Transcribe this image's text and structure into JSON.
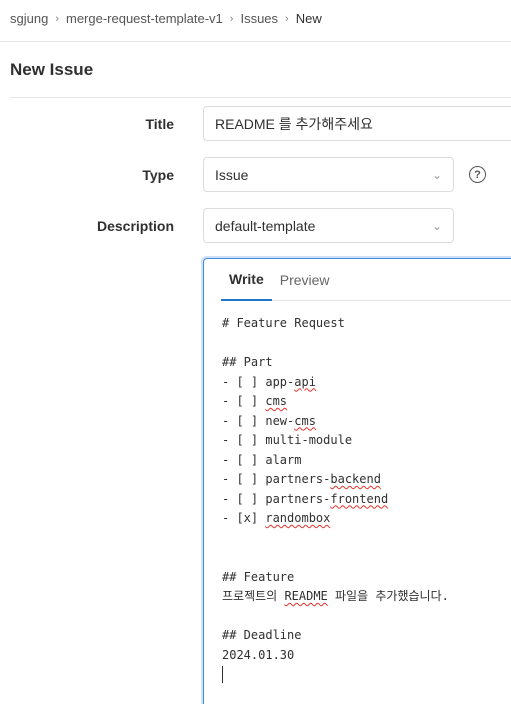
{
  "breadcrumb": {
    "items": [
      "sgjung",
      "merge-request-template-v1",
      "Issues",
      "New"
    ],
    "separator": "›"
  },
  "page": {
    "title": "New Issue"
  },
  "form": {
    "title_label": "Title",
    "title_value": "README 를 추가해주세요",
    "type_label": "Type",
    "type_value": "Issue",
    "help_icon": "?",
    "description_label": "Description",
    "template_value": "default-template"
  },
  "editor": {
    "tabs": [
      {
        "label": "Write",
        "active": true
      },
      {
        "label": "Preview",
        "active": false
      }
    ],
    "lines": [
      "# Feature Request",
      "",
      "## Part",
      "- [ ] app-api",
      "- [ ] cms",
      "- [ ] new-cms",
      "- [ ] multi-module",
      "- [ ] alarm",
      "- [ ] partners-backend",
      "- [ ] partners-frontend",
      "- [x] randombox",
      "",
      "",
      "## Feature",
      "프로젝트의 README 파일을 추가했습니다.",
      "",
      "## Deadline",
      "2024.01.30",
      ""
    ]
  },
  "colors": {
    "accent": "#1f75cb",
    "focus_border": "#428fdc",
    "spellcheck": "#e0322b"
  }
}
